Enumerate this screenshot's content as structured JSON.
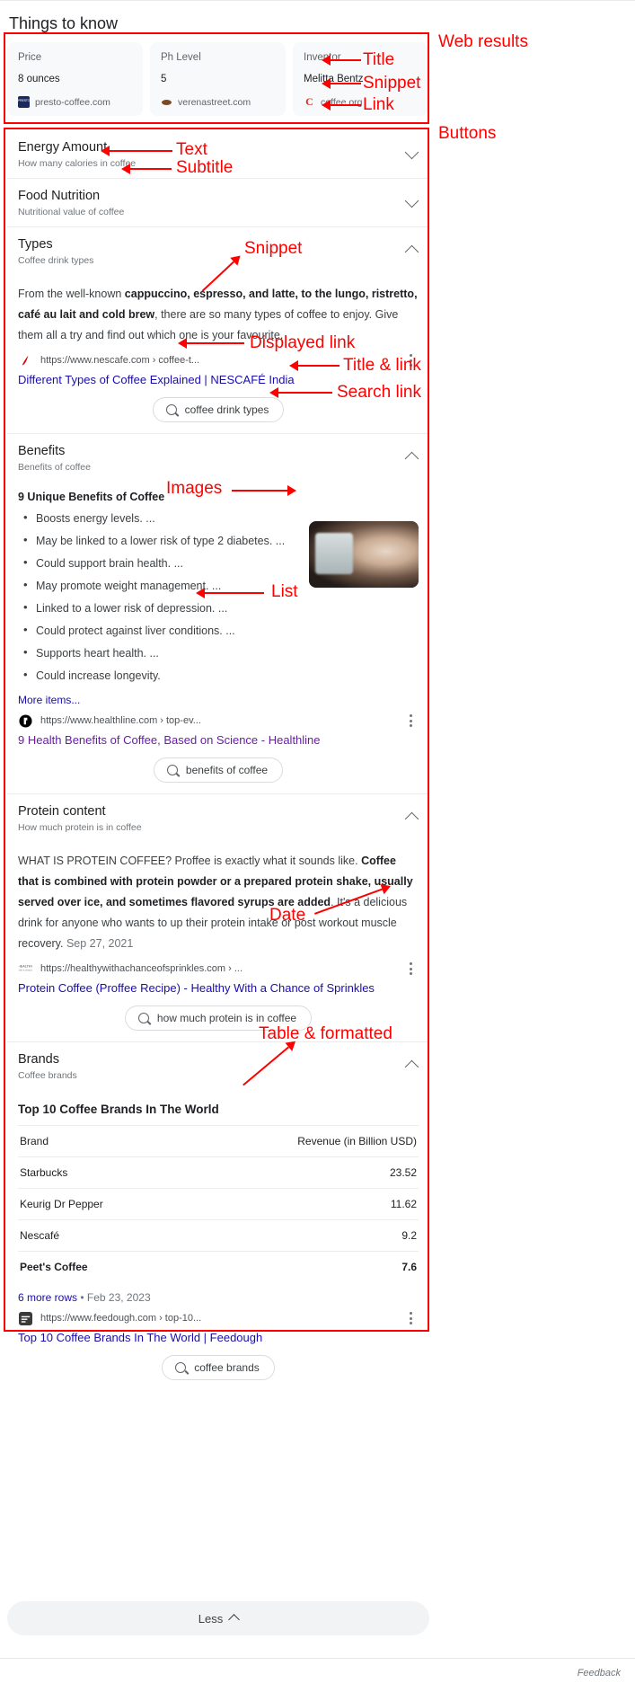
{
  "header": {
    "title": "Things to know"
  },
  "web_results": {
    "cards": [
      {
        "title": "Price",
        "snippet": "8 ounces",
        "link": "presto-coffee.com",
        "icon": "presto-favicon"
      },
      {
        "title": "Ph Level",
        "snippet": "5",
        "link": "verenastreet.com",
        "icon": "verenastreet-favicon"
      },
      {
        "title": "Inventor",
        "snippet": "Melitta Bentz",
        "link": "coffee.org",
        "icon": "coffeeorg-favicon"
      }
    ]
  },
  "sections": [
    {
      "title": "Energy Amount",
      "subtitle": "How many calories in coffee",
      "expanded": false
    },
    {
      "title": "Food Nutrition",
      "subtitle": "Nutritional value of coffee",
      "expanded": false
    },
    {
      "title": "Types",
      "subtitle": "Coffee drink types",
      "expanded": true,
      "snippet_parts": [
        {
          "text": "From the well-known ",
          "bold": false
        },
        {
          "text": "cappuccino, espresso, and latte, to the lungo, ristretto, café au lait and cold brew",
          "bold": true
        },
        {
          "text": ", there are so many types of coffee to enjoy. Give them all a try and find out which one is your favourite.",
          "bold": false
        }
      ],
      "url": "https://www.nescafe.com › coffee-t...",
      "result_title": "Different Types of Coffee Explained | NESCAFÉ India",
      "chip": "coffee drink types"
    },
    {
      "title": "Benefits",
      "subtitle": "Benefits of coffee",
      "expanded": true,
      "list_heading": "9 Unique Benefits of Coffee",
      "list_items": [
        "Boosts energy levels. ...",
        "May be linked to a lower risk of type 2 diabetes. ...",
        "Could support brain health. ...",
        "May promote weight management. ...",
        "Linked to a lower risk of depression. ...",
        "Could protect against liver conditions. ...",
        "Supports heart health. ...",
        "Could increase longevity."
      ],
      "more_items": "More items...",
      "url": "https://www.healthline.com › top-ev...",
      "result_title": "9 Health Benefits of Coffee, Based on Science - Healthline",
      "chip": "benefits of coffee"
    },
    {
      "title": "Protein content",
      "subtitle": "How much protein is in coffee",
      "expanded": true,
      "snippet_parts": [
        {
          "text": "WHAT IS PROTEIN COFFEE? Proffee is exactly what it sounds like. ",
          "bold": false
        },
        {
          "text": "Coffee that is combined with protein powder or a prepared protein shake, usually served over ice, and sometimes flavored syrups are added",
          "bold": true
        },
        {
          "text": ". It's a delicious drink for anyone who wants to up their protein intake or post workout muscle recovery. ",
          "bold": false
        }
      ],
      "date": "Sep 27, 2021",
      "url": "https://healthywithachanceofsprinkles.com › ...",
      "result_title": "Protein Coffee (Proffee Recipe) - Healthy With a Chance of Sprinkles",
      "chip": "how much protein is in coffee"
    },
    {
      "title": "Brands",
      "subtitle": "Coffee brands",
      "expanded": true,
      "table_title": "Top 10 Coffee Brands In The World",
      "table": {
        "columns": [
          "Brand",
          "Revenue (in Billion USD)"
        ],
        "rows": [
          {
            "brand": "Starbucks",
            "revenue": "23.52",
            "bold": false
          },
          {
            "brand": "Keurig Dr Pepper",
            "revenue": "11.62",
            "bold": false
          },
          {
            "brand": "Nescafé",
            "revenue": "9.2",
            "bold": false
          },
          {
            "brand": "Peet's Coffee",
            "revenue": "7.6",
            "bold": true
          }
        ]
      },
      "more_rows": "6 more rows",
      "table_date": "Feb 23, 2023",
      "url": "https://www.feedough.com › top-10...",
      "result_title": "Top 10 Coffee Brands In The World | Feedough",
      "chip": "coffee brands"
    }
  ],
  "footer": {
    "less_label": "Less",
    "feedback": "Feedback"
  },
  "annotations": {
    "web_results": "Web results",
    "title": "Title",
    "snippet_card": "Snippet",
    "link": "Link",
    "buttons": "Buttons",
    "text": "Text",
    "subtitle": "Subtitle",
    "snippet": "Snippet",
    "displayed_link": "Displayed link",
    "title_and_link": "Title & link",
    "search_link": "Search link",
    "images": "Images",
    "list": "List",
    "date": "Date",
    "table_formatted": "Table & formatted"
  },
  "colors": {
    "annotation": "#ff0000",
    "link": "#1a0dab",
    "visited_link": "#681da8",
    "card_bg": "#f8f9fa"
  }
}
